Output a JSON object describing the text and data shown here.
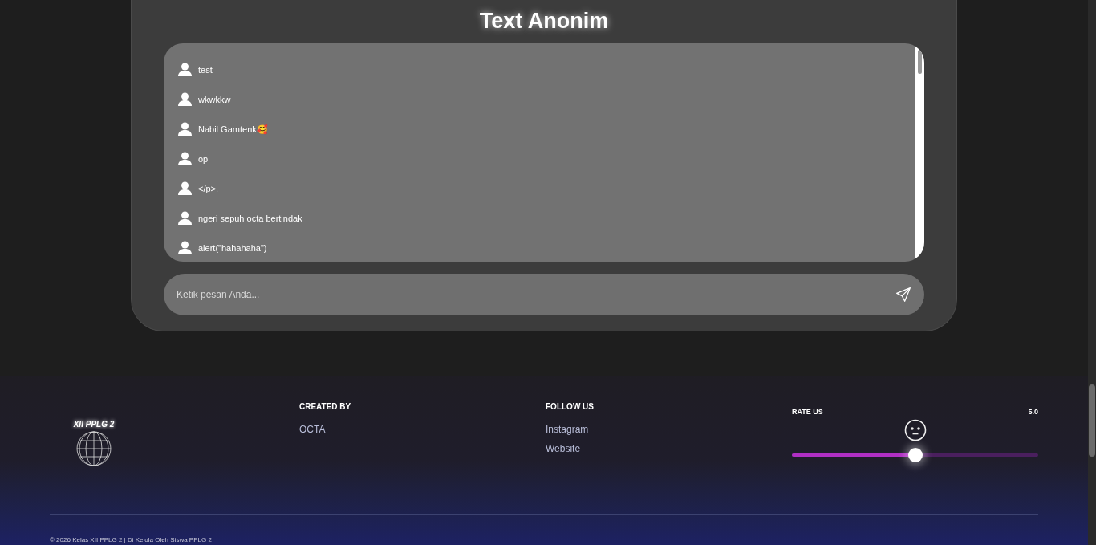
{
  "title": "Text Anonim",
  "messages": [
    {
      "text": "test"
    },
    {
      "text": "wkwkkw"
    },
    {
      "text": "Nabil Gamtenk🥰"
    },
    {
      "text": "op"
    },
    {
      "text": "</p>."
    },
    {
      "text": "ngeri sepuh octa bertindak"
    },
    {
      "text": "alert(\"hahahaha\")"
    }
  ],
  "composer": {
    "placeholder": "Ketik pesan Anda..."
  },
  "footer": {
    "logo_text": "XII PPLG 2",
    "created_by": {
      "heading": "CREATED BY",
      "links": [
        "OCTA"
      ]
    },
    "follow_us": {
      "heading": "FOLLOW US",
      "links": [
        "Instagram",
        "Website"
      ]
    },
    "rate_us": {
      "heading": "RATE US",
      "value": "5.0",
      "level": 0.5
    },
    "copyright": "© 2026 Kelas XII PPLG 2 | Di Kelola Oleh Siswa PPLG 2"
  }
}
